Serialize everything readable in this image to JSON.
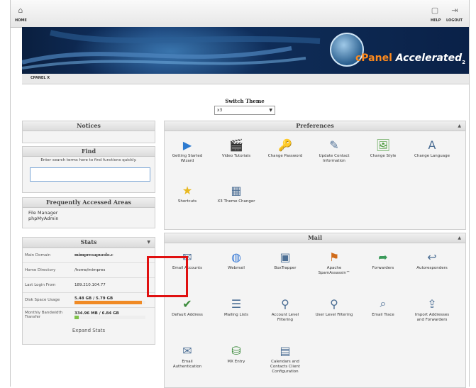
{
  "topbar": {
    "left_label": "HOME",
    "right_labels": [
      "HELP",
      "LOGOUT"
    ]
  },
  "banner": {
    "brand_cpanel": "cPanel",
    "brand_accelerated": "Accelerated",
    "brand_sub": "2"
  },
  "breadcrumb": {
    "text": "CPANEL X"
  },
  "switch_theme": {
    "title": "Switch Theme",
    "selected": "x3"
  },
  "left": {
    "notices": {
      "title": "Notices"
    },
    "find": {
      "title": "Find",
      "description": "Enter search terms here to find functions quickly.",
      "input_value": ""
    },
    "frequent": {
      "title": "Frequently Accessed Areas",
      "items": [
        "File Manager",
        "phpMyAdmin"
      ]
    },
    "stats": {
      "title": "Stats",
      "rows": [
        {
          "key": "Main Domain",
          "value": "mimpresapuedo.c"
        },
        {
          "key": "Home Directory",
          "value": "/home/mimpres"
        },
        {
          "key": "Last Login From",
          "value": "189.210.104.77"
        },
        {
          "key": "Disk Space Usage",
          "value": "5.48 GB / 5.79 GB"
        },
        {
          "key": "Monthly Bandwidth Transfer",
          "value": "334.96 MB / 6.84 GB"
        }
      ],
      "disk_fraction": 0.95,
      "bandwidth_fraction": 0.05,
      "expand": "Expand Stats"
    }
  },
  "preferences": {
    "title": "Preferences",
    "items": [
      {
        "label": "Getting Started Wizard",
        "icon": "getting-started-wizard-icon"
      },
      {
        "label": "Video Tutorials",
        "icon": "video-tutorials-icon"
      },
      {
        "label": "Change Password",
        "icon": "change-password-icon"
      },
      {
        "label": "Update Contact Information",
        "icon": "update-contact-icon"
      },
      {
        "label": "Change Style",
        "icon": "change-style-icon"
      },
      {
        "label": "Change Language",
        "icon": "change-language-icon"
      },
      {
        "label": "Shortcuts",
        "icon": "shortcuts-icon"
      },
      {
        "label": "X3 Theme Changer",
        "icon": "x3-theme-changer-icon"
      }
    ]
  },
  "mail": {
    "title": "Mail",
    "items": [
      {
        "label": "Email Accounts",
        "icon": "email-accounts-icon"
      },
      {
        "label": "Webmail",
        "icon": "webmail-icon"
      },
      {
        "label": "BoxTrapper",
        "icon": "boxtrapper-icon"
      },
      {
        "label": "Apache SpamAssassin™",
        "icon": "spamassassin-icon"
      },
      {
        "label": "Forwarders",
        "icon": "forwarders-icon"
      },
      {
        "label": "Autoresponders",
        "icon": "autoresponders-icon"
      },
      {
        "label": "Default Address",
        "icon": "default-address-icon"
      },
      {
        "label": "Mailing Lists",
        "icon": "mailing-lists-icon"
      },
      {
        "label": "Account Level Filtering",
        "icon": "account-filtering-icon"
      },
      {
        "label": "User Level Filtering",
        "icon": "user-filtering-icon"
      },
      {
        "label": "Email Trace",
        "icon": "email-trace-icon"
      },
      {
        "label": "Import Addresses and Forwarders",
        "icon": "import-addresses-icon"
      },
      {
        "label": "Email Authentication",
        "icon": "email-authentication-icon"
      },
      {
        "label": "MX Entry",
        "icon": "mx-entry-icon"
      },
      {
        "label": "Calendars and Contacts Client Configuration",
        "icon": "calendars-contacts-icon"
      }
    ]
  },
  "colors": {
    "banner_dark": "#0a1f3f",
    "brand_orange": "#ff8a1c",
    "highlight_red": "#e01010",
    "disk_bar": "#f08a24",
    "bandwidth_bar": "#7fc24a"
  }
}
